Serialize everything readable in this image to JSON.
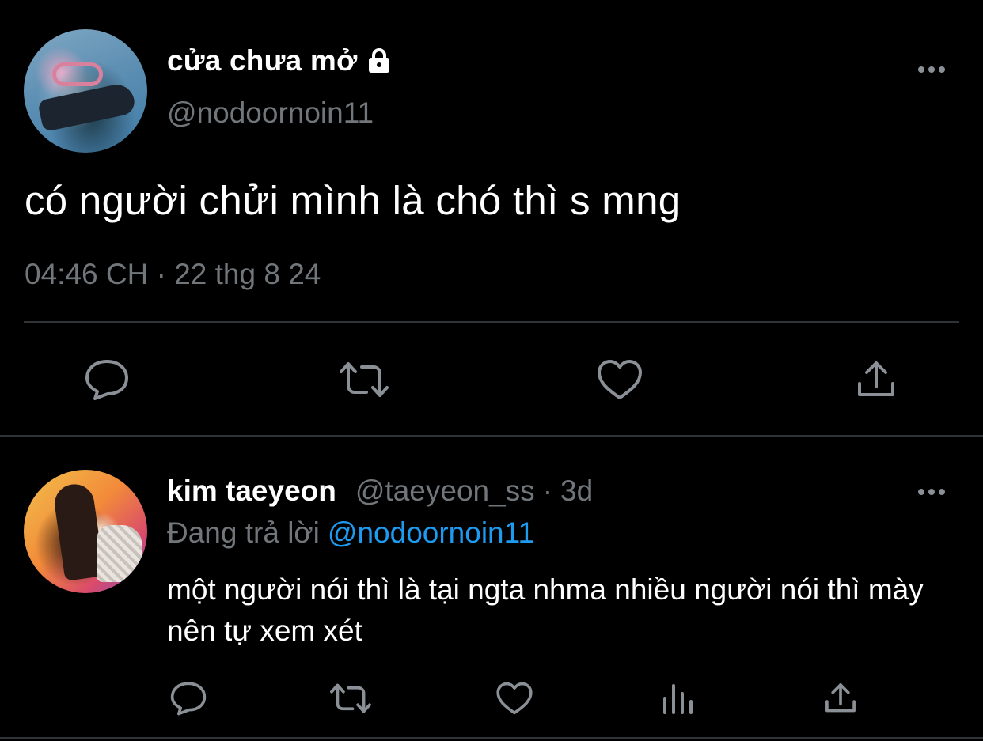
{
  "main_tweet": {
    "display_name": "cửa chưa mở",
    "handle": "@nodoornoin11",
    "protected_icon": "lock-icon",
    "text": "có người chửi mình là chó thì s mng",
    "timestamp": "04:46 CH · 22 thg 8 24",
    "actions": [
      "reply-icon",
      "retweet-icon",
      "like-icon",
      "share-icon"
    ]
  },
  "reply_tweet": {
    "display_name": "kim taeyeon",
    "handle": "@taeyeon_ss",
    "separator": "·",
    "time": "3d",
    "replying_label": "Đang trả lời",
    "replying_handle": "@nodoornoin11",
    "text": "một người nói thì là tại ngta nhma nhiều người nói thì mày nên tự xem xét",
    "actions": [
      "reply-icon",
      "retweet-icon",
      "like-icon",
      "views-icon",
      "share-icon"
    ]
  },
  "colors": {
    "background": "#000000",
    "primary_text": "#ffffff",
    "secondary_text": "#71767b",
    "link": "#1d9bf0",
    "divider": "#2f3336",
    "icon": "#8b9096"
  }
}
